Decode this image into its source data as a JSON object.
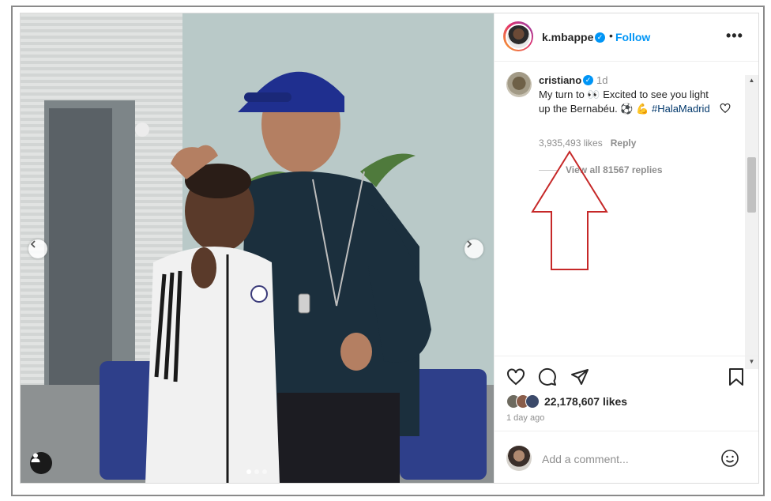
{
  "post": {
    "author": {
      "username": "k.mbappe",
      "verified": true,
      "follow_label": "Follow",
      "separator": "•",
      "more_label": "•••"
    },
    "comment": {
      "username": "cristiano",
      "verified": true,
      "time": "1d",
      "text_before": "My turn to 👀 Excited to see you light up the Bernabéu. ⚽ 💪 ",
      "hashtag": "#HalaMadrid",
      "likes": "3,935,493 likes",
      "reply_label": "Reply",
      "view_replies": "View all 81567 replies"
    },
    "likes": "22,178,607 likes",
    "time_ago": "1 day ago",
    "add_comment_placeholder": "Add a comment...",
    "carousel": {
      "slide_count": 3,
      "current_slide": 1
    }
  },
  "colors": {
    "link_blue": "#0095f6",
    "hashtag": "#00376b",
    "annotation_arrow": "#c62828"
  },
  "icons": {
    "nav_prev": "chevron-left-icon",
    "nav_next": "chevron-right-icon",
    "user_tag": "person-icon",
    "like": "heart-icon",
    "comment": "comment-bubble-icon",
    "share": "paper-plane-icon",
    "save": "bookmark-icon",
    "emoji": "smiley-icon",
    "more": "more-options-icon"
  }
}
